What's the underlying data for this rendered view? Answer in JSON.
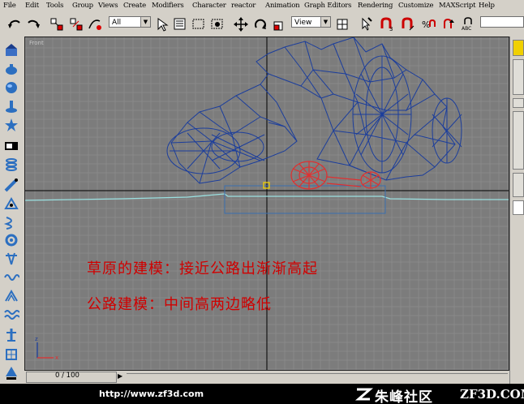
{
  "menu": [
    "File",
    "Edit",
    "Tools",
    "Group",
    "Views",
    "Create",
    "Modifiers",
    "Character",
    "reactor",
    "Animation",
    "Graph Editors",
    "Rendering",
    "Customize",
    "MAXScript",
    "Help"
  ],
  "toolbar": {
    "selection_filter": "All",
    "reference_coord": "View",
    "icons": [
      "undo-icon",
      "redo-icon",
      "link-icon",
      "unlink-icon",
      "bind-space-warp-icon",
      "select-icon",
      "select-by-name-icon",
      "rect-selection-region-icon",
      "window-crossing-icon",
      "move-icon",
      "rotate-icon",
      "scale-icon",
      "pivot-icon",
      "manipulate-icon",
      "snap-icon",
      "angle-snap-icon",
      "percent-snap-icon",
      "spinner-snap-icon",
      "edit-named-selection-icon"
    ]
  },
  "viewport": {
    "label": "Front",
    "annotations": [
      "草原的建模：接近公路出渐渐高起",
      "公路建模：中间高两边略低"
    ]
  },
  "timeslider": {
    "label": "0 / 100"
  },
  "footer": {
    "url": "http://www.zf3d.com",
    "logo_cn": "朱峰社区",
    "logo_en": "ZF3D.COM"
  },
  "colors": {
    "wire_blue": "#1c3e9c",
    "wire_red": "#e03030",
    "ground_cyan": "#9ae0e0",
    "grid": "#8e8e8e",
    "viewport_bg": "#7c7c7c",
    "selection_yellow": "#f0d000"
  }
}
